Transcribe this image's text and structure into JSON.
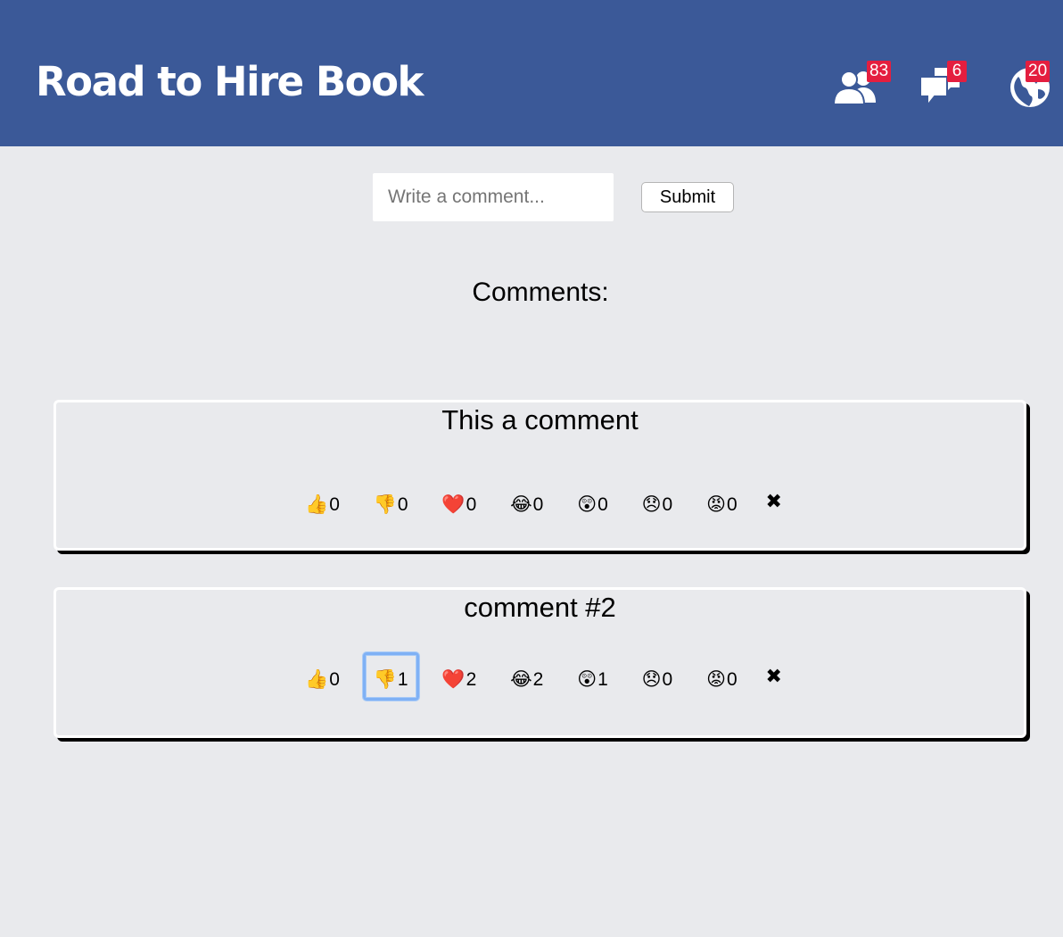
{
  "header": {
    "title": "Road to Hire Book",
    "icons": [
      {
        "name": "friends",
        "icon": "friend-requests-icon",
        "badge": "83"
      },
      {
        "name": "messages",
        "icon": "messages-icon",
        "badge": "6"
      },
      {
        "name": "notifications",
        "icon": "globe-icon",
        "badge": "20"
      }
    ],
    "colors": {
      "bar": "#3b5998",
      "badge": "#e41e3f"
    }
  },
  "composer": {
    "placeholder": "Write a comment...",
    "submit_label": "Submit"
  },
  "comments_heading": "Comments:",
  "comments": [
    {
      "text": "This a comment",
      "reactions": [
        {
          "emoji": "👍",
          "icon": "thumbs-up-icon",
          "count": "0"
        },
        {
          "emoji": "👎",
          "icon": "thumbs-down-icon",
          "count": "0"
        },
        {
          "emoji": "❤️",
          "icon": "heart-icon",
          "count": "0"
        },
        {
          "emoji": "😂",
          "icon": "laughing-icon",
          "count": "0"
        },
        {
          "emoji": "😲",
          "icon": "surprised-icon",
          "count": "0"
        },
        {
          "emoji": "😞",
          "icon": "sad-icon",
          "count": "0"
        },
        {
          "emoji": "😡",
          "icon": "angry-icon",
          "count": "0"
        }
      ],
      "delete_label": "✖"
    },
    {
      "text": "comment #2",
      "reactions": [
        {
          "emoji": "👍",
          "icon": "thumbs-up-icon",
          "count": "0"
        },
        {
          "emoji": "👎",
          "icon": "thumbs-down-icon",
          "count": "1"
        },
        {
          "emoji": "❤️",
          "icon": "heart-icon",
          "count": "2"
        },
        {
          "emoji": "😂",
          "icon": "laughing-icon",
          "count": "2"
        },
        {
          "emoji": "😲",
          "icon": "surprised-icon",
          "count": "1"
        },
        {
          "emoji": "😞",
          "icon": "sad-icon",
          "count": "0"
        },
        {
          "emoji": "😡",
          "icon": "angry-icon",
          "count": "0"
        }
      ],
      "delete_label": "✖"
    }
  ]
}
